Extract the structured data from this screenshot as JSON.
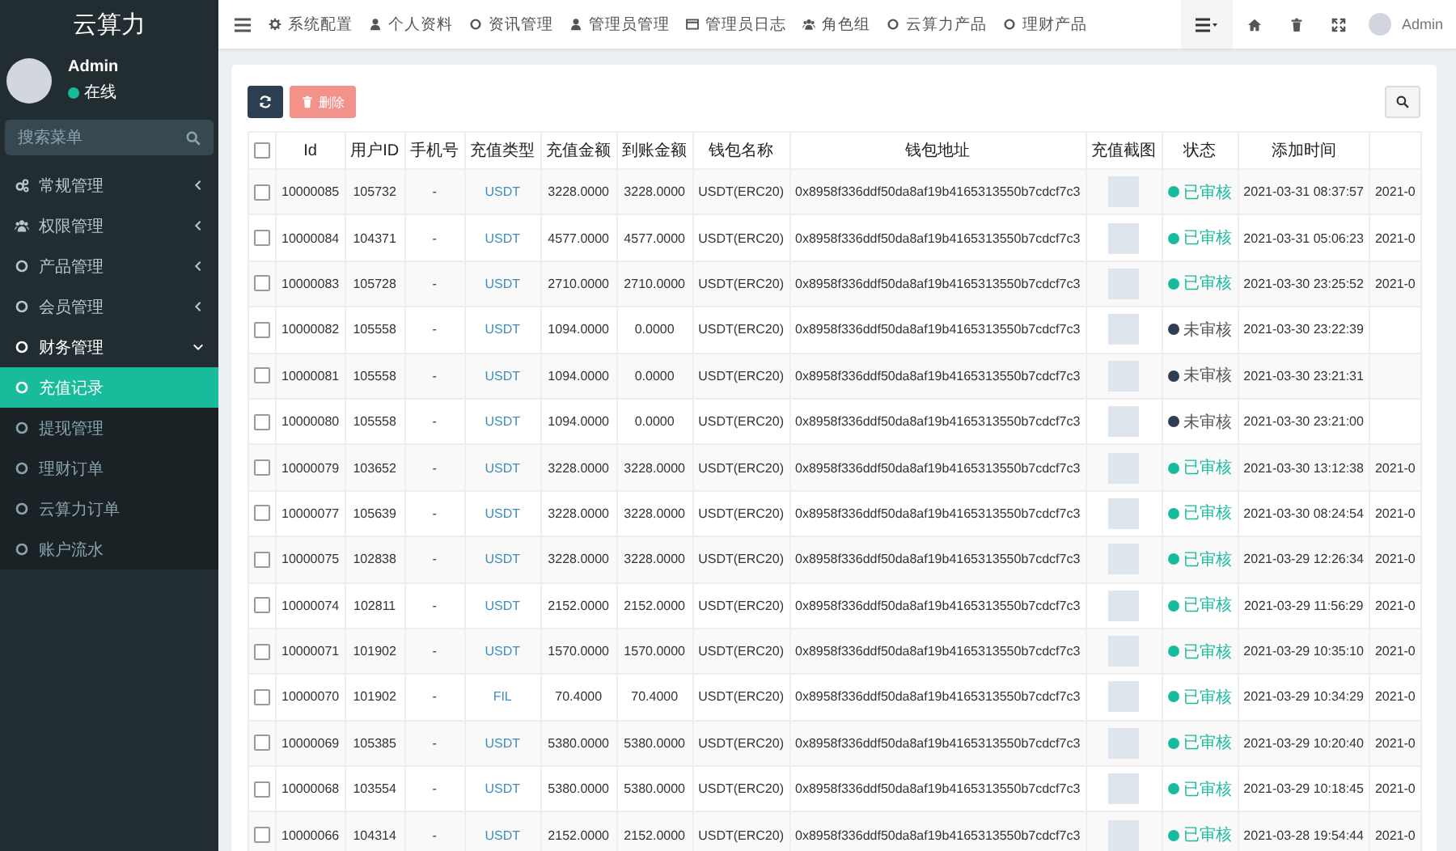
{
  "sidebar": {
    "logo": "云算力",
    "user": {
      "name": "Admin",
      "status": "在线",
      "online": true
    },
    "search": {
      "placeholder": "搜索菜单"
    },
    "menu": [
      {
        "label": "常规管理",
        "expanded": false
      },
      {
        "label": "权限管理",
        "expanded": false
      },
      {
        "label": "产品管理",
        "expanded": false
      },
      {
        "label": "会员管理",
        "expanded": false
      },
      {
        "label": "财务管理",
        "expanded": true,
        "children": [
          {
            "label": "充值记录",
            "selected": true
          },
          {
            "label": "提现管理",
            "selected": false
          },
          {
            "label": "理财订单",
            "selected": false
          },
          {
            "label": "云算力订单",
            "selected": false
          },
          {
            "label": "账户流水",
            "selected": false
          }
        ]
      }
    ]
  },
  "topbar": {
    "nav": [
      {
        "label": "系统配置"
      },
      {
        "label": "个人资料"
      },
      {
        "label": "资讯管理"
      },
      {
        "label": "管理员管理"
      },
      {
        "label": "管理员日志"
      },
      {
        "label": "角色组"
      },
      {
        "label": "云算力产品"
      },
      {
        "label": "理财产品"
      }
    ],
    "user": "Admin"
  },
  "toolbar": {
    "delete": {
      "label": "删除",
      "disabled": true
    }
  },
  "table": {
    "select_all": false,
    "columns": [
      "Id",
      "用户ID",
      "手机号",
      "充值类型",
      "充值金额",
      "到账金额",
      "钱包名称",
      "钱包地址",
      "充值截图",
      "状态",
      "添加时间"
    ],
    "rows": [
      {
        "checked": false,
        "id": "10000085",
        "user_id": "105732",
        "phone": "-",
        "type": "USDT",
        "amount": "3228.0000",
        "received": "3228.0000",
        "wallet": "USDT(ERC20)",
        "address": "0x8958f336ddf50da8af19b4165313550b7cdcf7c3",
        "status": {
          "label": "已审核",
          "kind": "approved"
        },
        "added": "2021-03-31 08:37:57",
        "column_12": "2021-0"
      },
      {
        "checked": false,
        "id": "10000084",
        "user_id": "104371",
        "phone": "-",
        "type": "USDT",
        "amount": "4577.0000",
        "received": "4577.0000",
        "wallet": "USDT(ERC20)",
        "address": "0x8958f336ddf50da8af19b4165313550b7cdcf7c3",
        "status": {
          "label": "已审核",
          "kind": "approved"
        },
        "added": "2021-03-31 05:06:23",
        "column_12": "2021-0"
      },
      {
        "checked": false,
        "id": "10000083",
        "user_id": "105728",
        "phone": "-",
        "type": "USDT",
        "amount": "2710.0000",
        "received": "2710.0000",
        "wallet": "USDT(ERC20)",
        "address": "0x8958f336ddf50da8af19b4165313550b7cdcf7c3",
        "status": {
          "label": "已审核",
          "kind": "approved"
        },
        "added": "2021-03-30 23:25:52",
        "column_12": "2021-0"
      },
      {
        "checked": false,
        "id": "10000082",
        "user_id": "105558",
        "phone": "-",
        "type": "USDT",
        "amount": "1094.0000",
        "received": "0.0000",
        "wallet": "USDT(ERC20)",
        "address": "0x8958f336ddf50da8af19b4165313550b7cdcf7c3",
        "status": {
          "label": "未审核",
          "kind": "pending"
        },
        "added": "2021-03-30 23:22:39"
      },
      {
        "checked": false,
        "id": "10000081",
        "user_id": "105558",
        "phone": "-",
        "type": "USDT",
        "amount": "1094.0000",
        "received": "0.0000",
        "wallet": "USDT(ERC20)",
        "address": "0x8958f336ddf50da8af19b4165313550b7cdcf7c3",
        "status": {
          "label": "未审核",
          "kind": "pending"
        },
        "added": "2021-03-30 23:21:31"
      },
      {
        "checked": false,
        "id": "10000080",
        "user_id": "105558",
        "phone": "-",
        "type": "USDT",
        "amount": "1094.0000",
        "received": "0.0000",
        "wallet": "USDT(ERC20)",
        "address": "0x8958f336ddf50da8af19b4165313550b7cdcf7c3",
        "status": {
          "label": "未审核",
          "kind": "pending"
        },
        "added": "2021-03-30 23:21:00"
      },
      {
        "checked": false,
        "id": "10000079",
        "user_id": "103652",
        "phone": "-",
        "type": "USDT",
        "amount": "3228.0000",
        "received": "3228.0000",
        "wallet": "USDT(ERC20)",
        "address": "0x8958f336ddf50da8af19b4165313550b7cdcf7c3",
        "status": {
          "label": "已审核",
          "kind": "approved"
        },
        "added": "2021-03-30 13:12:38",
        "column_12": "2021-0"
      },
      {
        "checked": false,
        "id": "10000077",
        "user_id": "105639",
        "phone": "-",
        "type": "USDT",
        "amount": "3228.0000",
        "received": "3228.0000",
        "wallet": "USDT(ERC20)",
        "address": "0x8958f336ddf50da8af19b4165313550b7cdcf7c3",
        "status": {
          "label": "已审核",
          "kind": "approved"
        },
        "added": "2021-03-30 08:24:54",
        "column_12": "2021-0"
      },
      {
        "checked": false,
        "id": "10000075",
        "user_id": "102838",
        "phone": "-",
        "type": "USDT",
        "amount": "3228.0000",
        "received": "3228.0000",
        "wallet": "USDT(ERC20)",
        "address": "0x8958f336ddf50da8af19b4165313550b7cdcf7c3",
        "status": {
          "label": "已审核",
          "kind": "approved"
        },
        "added": "2021-03-29 12:26:34",
        "column_12": "2021-0"
      },
      {
        "checked": false,
        "id": "10000074",
        "user_id": "102811",
        "phone": "-",
        "type": "USDT",
        "amount": "2152.0000",
        "received": "2152.0000",
        "wallet": "USDT(ERC20)",
        "address": "0x8958f336ddf50da8af19b4165313550b7cdcf7c3",
        "status": {
          "label": "已审核",
          "kind": "approved"
        },
        "added": "2021-03-29 11:56:29",
        "column_12": "2021-0"
      },
      {
        "checked": false,
        "id": "10000071",
        "user_id": "101902",
        "phone": "-",
        "type": "USDT",
        "amount": "1570.0000",
        "received": "1570.0000",
        "wallet": "USDT(ERC20)",
        "address": "0x8958f336ddf50da8af19b4165313550b7cdcf7c3",
        "status": {
          "label": "已审核",
          "kind": "approved"
        },
        "added": "2021-03-29 10:35:10",
        "column_12": "2021-0"
      },
      {
        "checked": false,
        "id": "10000070",
        "user_id": "101902",
        "phone": "-",
        "type": "FIL",
        "amount": "70.4000",
        "received": "70.4000",
        "wallet": "USDT(ERC20)",
        "address": "0x8958f336ddf50da8af19b4165313550b7cdcf7c3",
        "status": {
          "label": "已审核",
          "kind": "approved"
        },
        "added": "2021-03-29 10:34:29",
        "column_12": "2021-0"
      },
      {
        "checked": false,
        "id": "10000069",
        "user_id": "105385",
        "phone": "-",
        "type": "USDT",
        "amount": "5380.0000",
        "received": "5380.0000",
        "wallet": "USDT(ERC20)",
        "address": "0x8958f336ddf50da8af19b4165313550b7cdcf7c3",
        "status": {
          "label": "已审核",
          "kind": "approved"
        },
        "added": "2021-03-29 10:20:40",
        "column_12": "2021-0"
      },
      {
        "checked": false,
        "id": "10000068",
        "user_id": "103554",
        "phone": "-",
        "type": "USDT",
        "amount": "5380.0000",
        "received": "5380.0000",
        "wallet": "USDT(ERC20)",
        "address": "0x8958f336ddf50da8af19b4165313550b7cdcf7c3",
        "status": {
          "label": "已审核",
          "kind": "approved"
        },
        "added": "2021-03-29 10:18:45",
        "column_12": "2021-0"
      },
      {
        "checked": false,
        "id": "10000066",
        "user_id": "104314",
        "phone": "-",
        "type": "USDT",
        "amount": "2152.0000",
        "received": "2152.0000",
        "wallet": "USDT(ERC20)",
        "address": "0x8958f336ddf50da8af19b4165313550b7cdcf7c3",
        "status": {
          "label": "已审核",
          "kind": "approved"
        },
        "added": "2021-03-28 19:54:44",
        "column_12": "2021-0"
      }
    ]
  }
}
